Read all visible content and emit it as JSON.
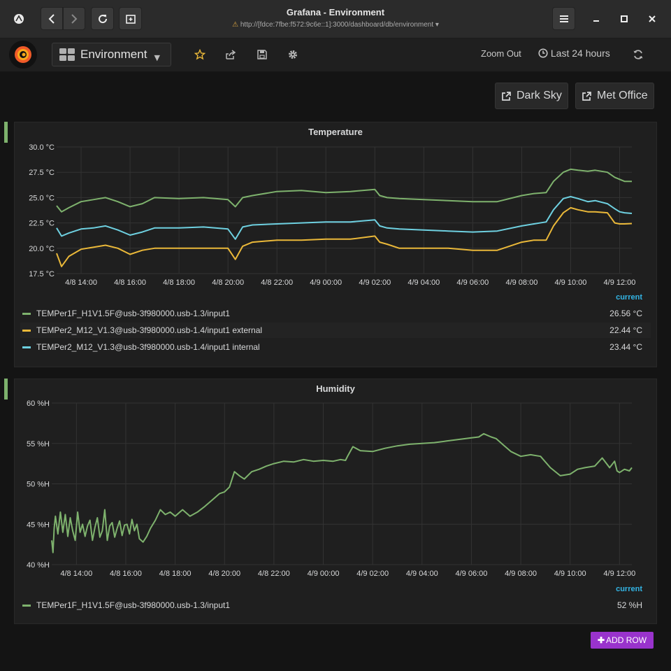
{
  "window": {
    "title": "Grafana - Environment",
    "url": "http://[fdce:7fbe:f572:9c6e::1]:3000/dashboard/db/environment"
  },
  "navbar": {
    "dashboard_title": "Environment",
    "zoom_out": "Zoom Out",
    "time_range": "Last 24 hours"
  },
  "links": [
    {
      "label": "Dark Sky"
    },
    {
      "label": "Met Office"
    }
  ],
  "colors": {
    "green": "#7eb26d",
    "yellow": "#eab839",
    "cyan": "#6ed0e0",
    "accent_blue": "#33b5e5",
    "add_row": "#9933cc"
  },
  "temperature_panel": {
    "title": "Temperature",
    "legend_header": "current",
    "legend": [
      {
        "name": "TEMPer1F_H1V1.5F@usb-3f980000.usb-1.3/input1",
        "value": "26.56 °C",
        "color": "#7eb26d"
      },
      {
        "name": "TEMPer2_M12_V1.3@usb-3f980000.usb-1.4/input1 external",
        "value": "22.44 °C",
        "color": "#eab839"
      },
      {
        "name": "TEMPer2_M12_V1.3@usb-3f980000.usb-1.4/input1 internal",
        "value": "23.44 °C",
        "color": "#6ed0e0"
      }
    ]
  },
  "humidity_panel": {
    "title": "Humidity",
    "legend_header": "current",
    "legend": [
      {
        "name": "TEMPer1F_H1V1.5F@usb-3f980000.usb-1.3/input1",
        "value": "52 %H",
        "color": "#7eb26d"
      }
    ]
  },
  "add_row": "ADD ROW",
  "chart_data": [
    {
      "type": "line",
      "title": "Temperature",
      "y_unit": "°C",
      "ylim": [
        17.5,
        30.0
      ],
      "yticks": [
        "30.0 °C",
        "27.5 °C",
        "25.0 °C",
        "22.5 °C",
        "20.0 °C",
        "17.5 °C"
      ],
      "y_tick_values": [
        30.0,
        27.5,
        25.0,
        22.5,
        20.0,
        17.5
      ],
      "xlim": [
        13.0,
        36.5
      ],
      "xticks": [
        "4/8 14:00",
        "4/8 16:00",
        "4/8 18:00",
        "4/8 20:00",
        "4/8 22:00",
        "4/9 00:00",
        "4/9 02:00",
        "4/9 04:00",
        "4/9 06:00",
        "4/9 08:00",
        "4/9 10:00",
        "4/9 12:00"
      ],
      "x_tick_hours": [
        14,
        16,
        18,
        20,
        22,
        24,
        26,
        28,
        30,
        32,
        34,
        36
      ],
      "grid": true,
      "series": [
        {
          "name": "TEMPer1F_H1V1.5F@usb-3f980000.usb-1.3/input1",
          "color": "#7eb26d",
          "x": [
            13.0,
            13.2,
            13.5,
            14.0,
            14.5,
            15.0,
            15.5,
            16.0,
            16.5,
            17.0,
            18.0,
            19.0,
            20.0,
            20.3,
            20.6,
            21.0,
            22.0,
            23.0,
            24.0,
            25.0,
            26.0,
            26.2,
            26.5,
            27.0,
            28.0,
            29.0,
            30.0,
            31.0,
            32.0,
            32.5,
            33.0,
            33.3,
            33.7,
            34.0,
            34.3,
            34.7,
            35.0,
            35.5,
            35.8,
            36.0,
            36.2,
            36.5
          ],
          "y": [
            24.2,
            23.6,
            24.0,
            24.6,
            24.8,
            25.0,
            24.6,
            24.1,
            24.4,
            25.0,
            24.9,
            25.0,
            24.8,
            24.1,
            25.0,
            25.2,
            25.6,
            25.7,
            25.5,
            25.6,
            25.8,
            25.2,
            25.0,
            24.9,
            24.8,
            24.7,
            24.6,
            24.6,
            25.2,
            25.4,
            25.5,
            26.6,
            27.5,
            27.8,
            27.7,
            27.6,
            27.7,
            27.5,
            27.0,
            26.8,
            26.6,
            26.6
          ]
        },
        {
          "name": "TEMPer2_M12_V1.3@usb-3f980000.usb-1.4/input1 external",
          "color": "#eab839",
          "x": [
            13.0,
            13.2,
            13.5,
            14.0,
            14.5,
            15.0,
            15.5,
            16.0,
            16.5,
            17.0,
            18.0,
            19.0,
            20.0,
            20.3,
            20.6,
            21.0,
            22.0,
            23.0,
            24.0,
            25.0,
            26.0,
            26.2,
            26.5,
            27.0,
            28.0,
            29.0,
            30.0,
            31.0,
            32.0,
            32.5,
            33.0,
            33.3,
            33.7,
            34.0,
            34.3,
            34.7,
            35.0,
            35.5,
            35.8,
            36.0,
            36.2,
            36.5
          ],
          "y": [
            19.5,
            18.2,
            19.2,
            19.9,
            20.1,
            20.3,
            20.0,
            19.4,
            19.8,
            20.0,
            20.0,
            20.0,
            20.0,
            18.9,
            20.2,
            20.6,
            20.8,
            20.8,
            20.9,
            20.9,
            21.2,
            20.6,
            20.4,
            20.0,
            20.0,
            20.0,
            19.8,
            19.8,
            20.6,
            20.8,
            20.8,
            22.2,
            23.5,
            24.0,
            23.8,
            23.6,
            23.6,
            23.5,
            22.5,
            22.4,
            22.4,
            22.44
          ]
        },
        {
          "name": "TEMPer2_M12_V1.3@usb-3f980000.usb-1.4/input1 internal",
          "color": "#6ed0e0",
          "x": [
            13.0,
            13.2,
            13.5,
            14.0,
            14.5,
            15.0,
            15.5,
            16.0,
            16.5,
            17.0,
            18.0,
            19.0,
            20.0,
            20.3,
            20.6,
            21.0,
            22.0,
            23.0,
            24.0,
            25.0,
            26.0,
            26.2,
            26.5,
            27.0,
            28.0,
            29.0,
            30.0,
            31.0,
            32.0,
            32.5,
            33.0,
            33.3,
            33.7,
            34.0,
            34.3,
            34.7,
            35.0,
            35.5,
            35.8,
            36.0,
            36.2,
            36.5
          ],
          "y": [
            22.0,
            21.2,
            21.5,
            21.9,
            22.0,
            22.2,
            21.8,
            21.3,
            21.6,
            22.0,
            22.0,
            22.1,
            21.9,
            20.9,
            22.1,
            22.3,
            22.4,
            22.5,
            22.6,
            22.6,
            22.8,
            22.2,
            22.0,
            21.9,
            21.8,
            21.7,
            21.6,
            21.7,
            22.2,
            22.4,
            22.6,
            23.8,
            24.9,
            25.1,
            24.9,
            24.6,
            24.7,
            24.4,
            23.9,
            23.6,
            23.5,
            23.44
          ]
        }
      ]
    },
    {
      "type": "line",
      "title": "Humidity",
      "y_unit": "%H",
      "ylim": [
        40,
        60
      ],
      "yticks": [
        "60 %H",
        "55 %H",
        "50 %H",
        "45 %H",
        "40 %H"
      ],
      "y_tick_values": [
        60,
        55,
        50,
        45,
        40
      ],
      "xlim": [
        13.0,
        36.5
      ],
      "xticks": [
        "4/8 14:00",
        "4/8 16:00",
        "4/8 18:00",
        "4/8 20:00",
        "4/8 22:00",
        "4/9 00:00",
        "4/9 02:00",
        "4/9 04:00",
        "4/9 06:00",
        "4/9 08:00",
        "4/9 10:00",
        "4/9 12:00"
      ],
      "x_tick_hours": [
        14,
        16,
        18,
        20,
        22,
        24,
        26,
        28,
        30,
        32,
        34,
        36
      ],
      "grid": true,
      "series": [
        {
          "name": "TEMPer1F_H1V1.5F@usb-3f980000.usb-1.3/input1",
          "color": "#7eb26d",
          "x": [
            13.0,
            13.05,
            13.1,
            13.15,
            13.25,
            13.35,
            13.45,
            13.55,
            13.65,
            13.75,
            13.85,
            13.95,
            14.05,
            14.15,
            14.25,
            14.35,
            14.45,
            14.55,
            14.65,
            14.75,
            14.85,
            14.95,
            15.05,
            15.15,
            15.25,
            15.35,
            15.45,
            15.55,
            15.65,
            15.75,
            15.85,
            15.95,
            16.05,
            16.15,
            16.25,
            16.35,
            16.45,
            16.55,
            16.7,
            16.85,
            17.0,
            17.2,
            17.4,
            17.6,
            17.8,
            18.0,
            18.3,
            18.6,
            18.9,
            19.2,
            19.5,
            19.8,
            20.0,
            20.2,
            20.4,
            20.6,
            20.8,
            21.1,
            21.4,
            21.7,
            22.0,
            22.4,
            22.8,
            23.2,
            23.6,
            24.0,
            24.4,
            24.7,
            24.9,
            25.0,
            25.2,
            25.5,
            26.0,
            26.5,
            27.0,
            27.5,
            28.0,
            28.5,
            29.0,
            29.5,
            30.0,
            30.3,
            30.5,
            30.8,
            31.0,
            31.3,
            31.6,
            32.0,
            32.4,
            32.8,
            33.2,
            33.6,
            34.0,
            34.3,
            34.6,
            35.0,
            35.3,
            35.6,
            35.8,
            35.9,
            36.0,
            36.2,
            36.4,
            36.5
          ],
          "y": [
            43.0,
            41.5,
            44.5,
            46.0,
            43.8,
            46.5,
            44.0,
            46.2,
            43.5,
            45.8,
            44.2,
            43.0,
            46.5,
            44.0,
            45.0,
            43.5,
            44.8,
            45.5,
            43.0,
            44.6,
            45.8,
            43.4,
            44.2,
            46.8,
            43.0,
            44.8,
            45.2,
            43.4,
            44.5,
            45.4,
            43.6,
            44.9,
            45.0,
            43.8,
            45.6,
            44.2,
            45.0,
            43.2,
            42.8,
            43.5,
            44.5,
            45.5,
            46.8,
            46.2,
            46.5,
            46.0,
            46.8,
            46.0,
            46.5,
            47.2,
            48.0,
            48.8,
            49.0,
            49.6,
            51.5,
            51.0,
            50.6,
            51.5,
            51.8,
            52.2,
            52.5,
            52.8,
            52.7,
            53.0,
            52.8,
            52.9,
            52.8,
            53.0,
            52.9,
            53.5,
            54.6,
            54.1,
            54.0,
            54.4,
            54.7,
            54.9,
            55.0,
            55.1,
            55.3,
            55.5,
            55.7,
            55.8,
            56.2,
            55.8,
            55.6,
            54.8,
            54.0,
            53.4,
            53.6,
            53.4,
            52.0,
            51.0,
            51.2,
            51.8,
            52.0,
            52.2,
            53.2,
            52.0,
            52.8,
            51.6,
            51.4,
            51.8,
            51.6,
            52.0
          ]
        }
      ]
    }
  ]
}
